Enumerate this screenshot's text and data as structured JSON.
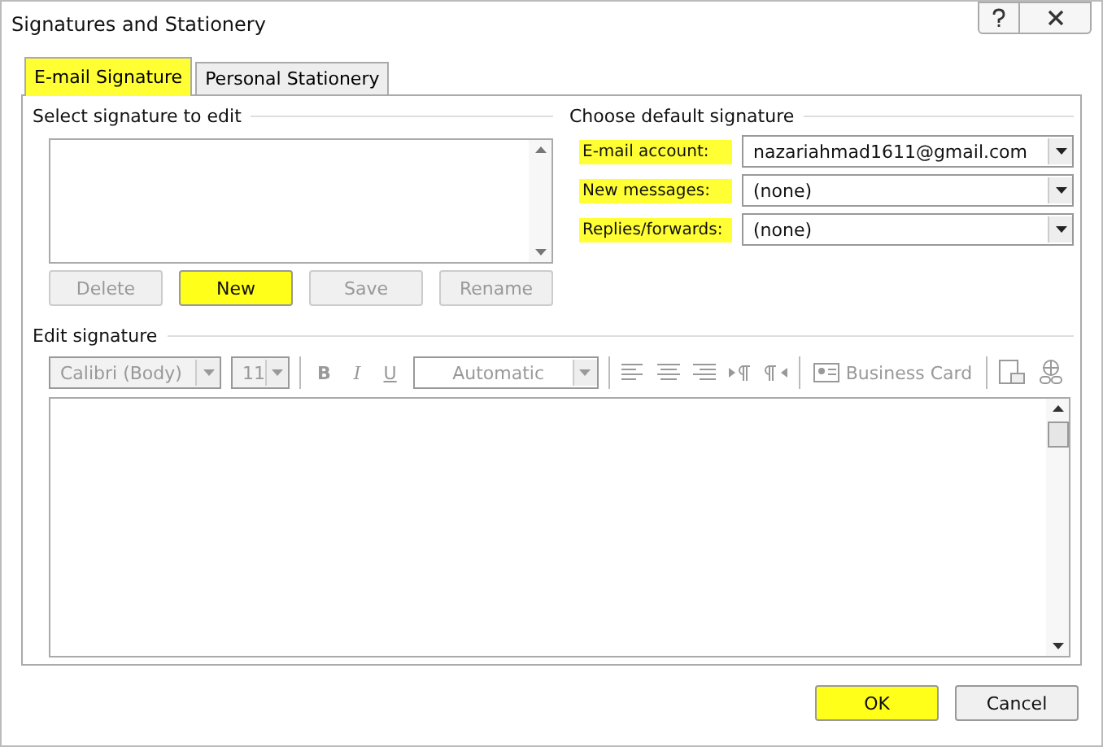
{
  "window": {
    "title": "Signatures and Stationery"
  },
  "tabs": [
    {
      "label": "E-mail Signature",
      "selected": true,
      "highlighted": true
    },
    {
      "label": "Personal Stationery",
      "selected": false,
      "highlighted": false
    }
  ],
  "select_signature": {
    "heading": "Select signature to edit",
    "buttons": [
      {
        "label": "Delete",
        "disabled": true,
        "highlighted": false
      },
      {
        "label": "New",
        "disabled": false,
        "highlighted": true
      },
      {
        "label": "Save",
        "disabled": true,
        "highlighted": false
      },
      {
        "label": "Rename",
        "disabled": true,
        "highlighted": false
      }
    ]
  },
  "default_signature": {
    "heading": "Choose default signature",
    "fields": [
      {
        "label": "E-mail account:",
        "value": "nazariahmad1611@gmail.com",
        "highlighted": true
      },
      {
        "label": "New messages:",
        "value": "(none)",
        "highlighted": true
      },
      {
        "label": "Replies/forwards:",
        "value": "(none)",
        "highlighted": true
      }
    ]
  },
  "edit_signature": {
    "heading": "Edit signature",
    "toolbar_disabled": true,
    "font": "Calibri (Body)",
    "size": "11",
    "bold": "B",
    "italic": "I",
    "underline": "U",
    "font_color": "Automatic",
    "business_card": "Business Card"
  },
  "buttons": [
    {
      "label": "OK",
      "highlighted": true
    },
    {
      "label": "Cancel",
      "highlighted": false
    }
  ]
}
